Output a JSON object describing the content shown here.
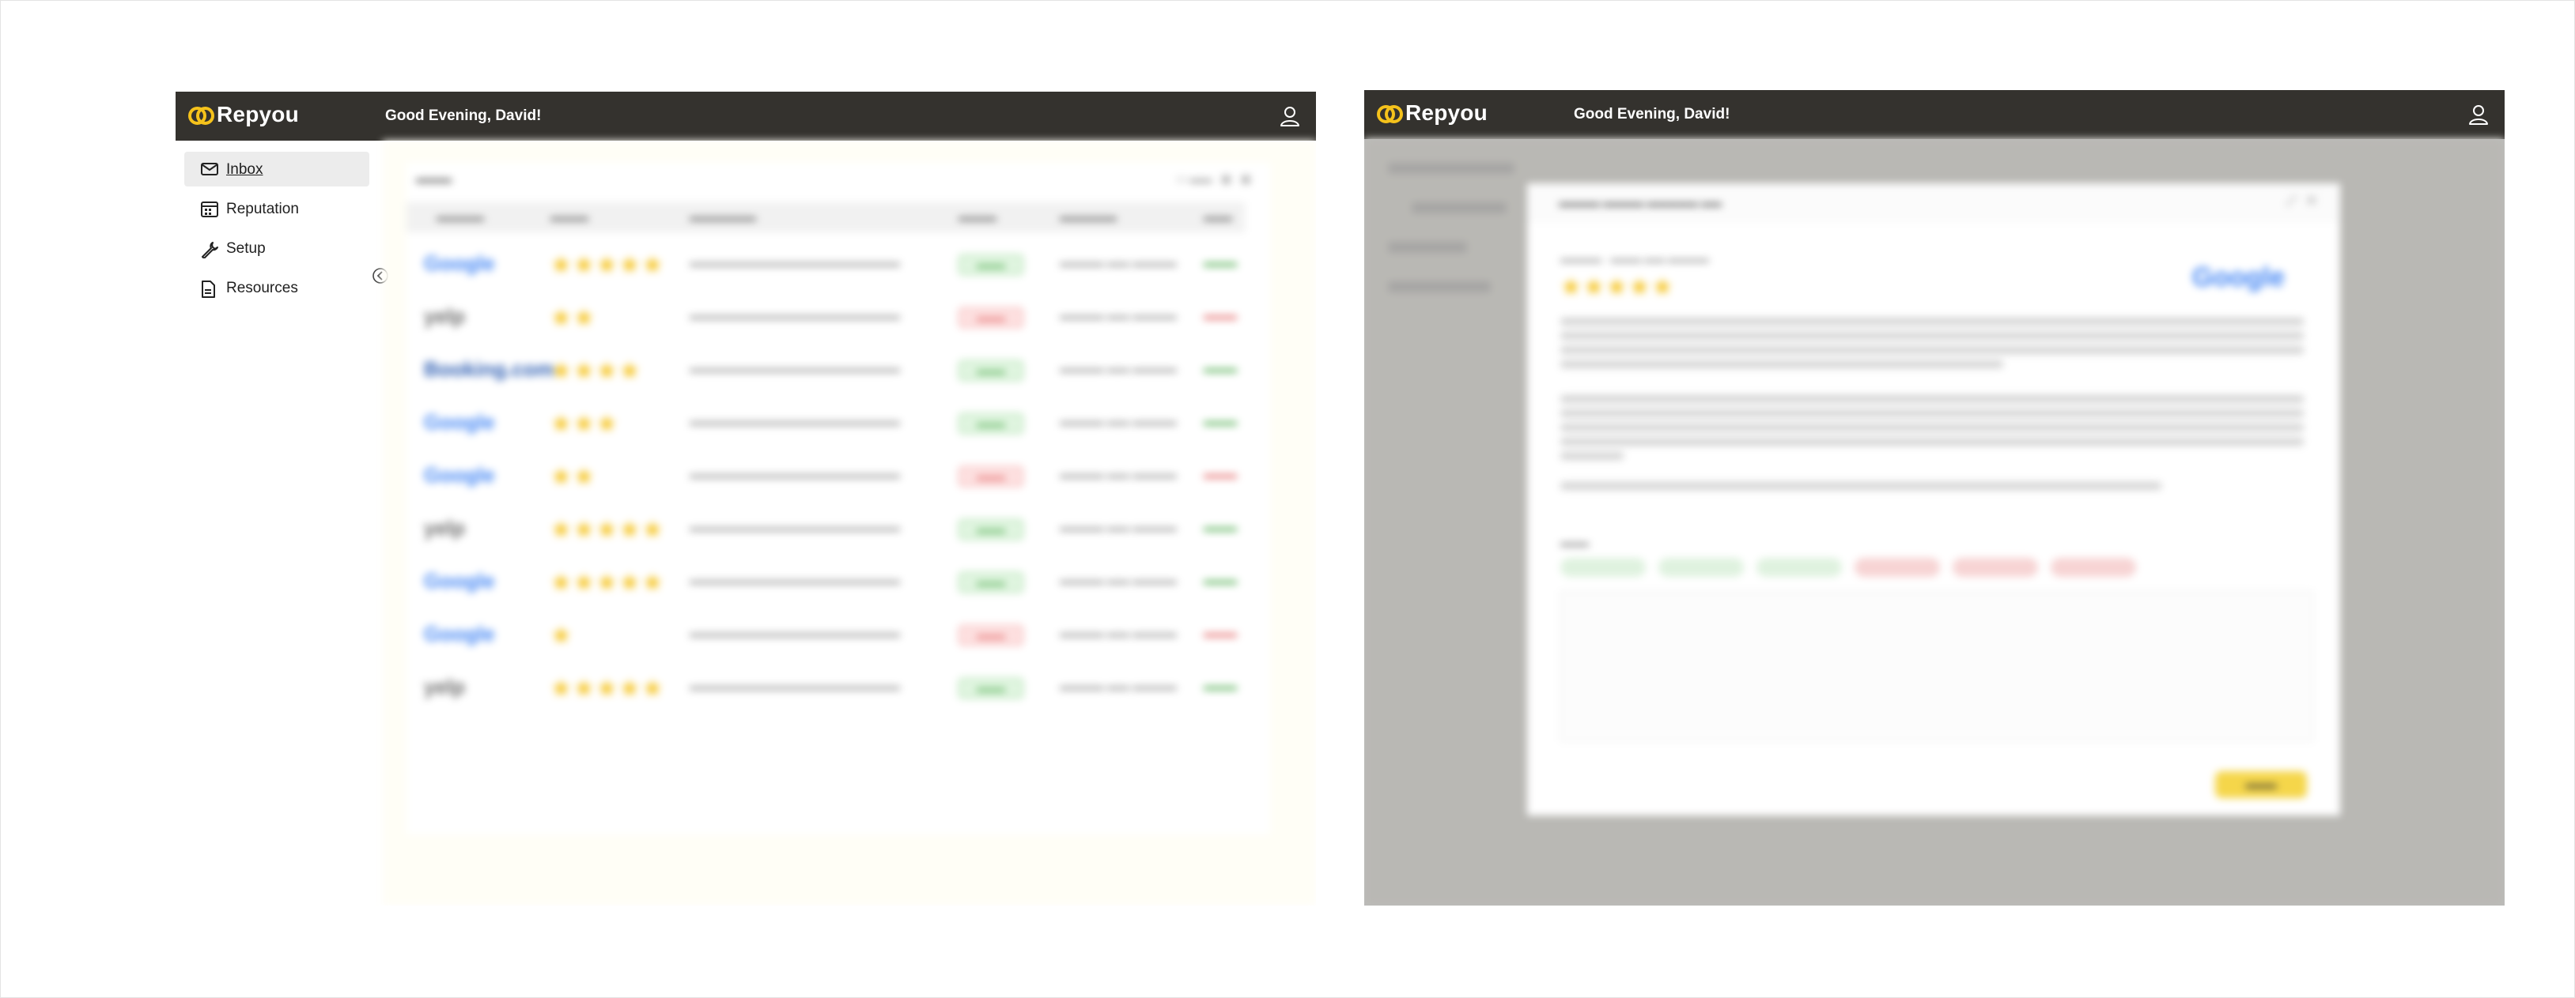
{
  "app": {
    "brand": "Repyou",
    "greeting": "Good Evening, David!"
  },
  "colors": {
    "topbar": "#34322e",
    "brand_accent": "#f5c21b",
    "sidebar_active": "#ececec",
    "positive": "#4aaa4a",
    "negative": "#e26262"
  },
  "icons": {
    "logo": "repyou-rings-icon",
    "user": "user-icon",
    "inbox": "envelope-icon",
    "reputation": "calendar-grid-icon",
    "setup": "wrench-icon",
    "resources": "document-icon",
    "collapse": "chevron-left-circle-icon"
  },
  "sidebar": {
    "items": [
      {
        "label": "Inbox",
        "active": true
      },
      {
        "label": "Reputation",
        "active": false
      },
      {
        "label": "Setup",
        "active": false
      },
      {
        "label": "Resources",
        "active": false
      }
    ]
  },
  "inbox_table": {
    "rows": [
      {
        "source": "Google",
        "stars": 5,
        "sentiment": "positive"
      },
      {
        "source": "yelp",
        "stars": 2,
        "sentiment": "negative"
      },
      {
        "source": "Booking.com",
        "stars": 4,
        "sentiment": "positive"
      },
      {
        "source": "Google",
        "stars": 3,
        "sentiment": "positive"
      },
      {
        "source": "Google",
        "stars": 2,
        "sentiment": "negative"
      },
      {
        "source": "yelp",
        "stars": 5,
        "sentiment": "positive"
      },
      {
        "source": "Google",
        "stars": 5,
        "sentiment": "positive"
      },
      {
        "source": "Google",
        "stars": 1,
        "sentiment": "negative"
      },
      {
        "source": "yelp",
        "stars": 5,
        "sentiment": "positive"
      }
    ]
  },
  "modal": {
    "stars": 5,
    "source": "Google"
  }
}
